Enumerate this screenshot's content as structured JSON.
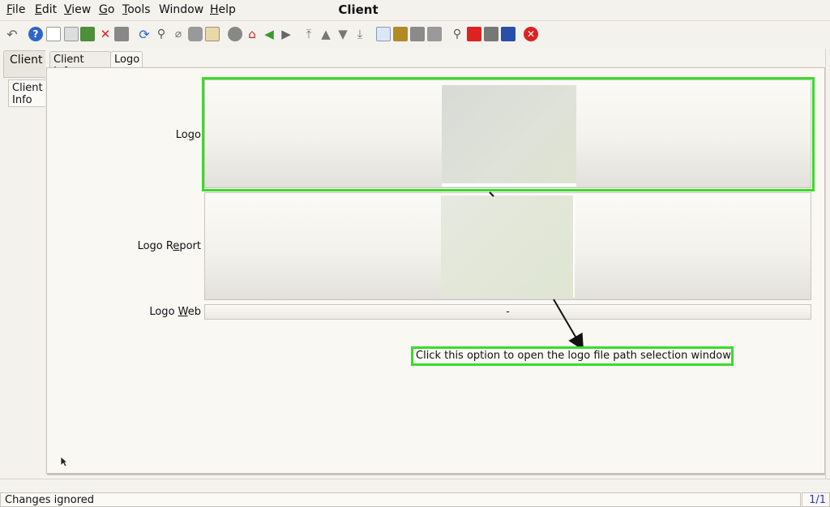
{
  "menubar": {
    "items": [
      {
        "pre": "",
        "key": "F",
        "post": "ile"
      },
      {
        "pre": "",
        "key": "E",
        "post": "dit"
      },
      {
        "pre": "",
        "key": "V",
        "post": "iew"
      },
      {
        "pre": "",
        "key": "G",
        "post": "o"
      },
      {
        "pre": "",
        "key": "T",
        "post": "ools"
      },
      {
        "pre": "Window",
        "key": "",
        "post": ""
      },
      {
        "pre": "",
        "key": "H",
        "post": "elp"
      }
    ],
    "title": "Client"
  },
  "toolbar": {
    "icons": [
      "undo-icon",
      "help-icon",
      "new-record-icon",
      "copy-record-icon",
      "save-record-icon",
      "delete-icon",
      "save-icon",
      "refresh-icon",
      "find-icon",
      "attachment-icon",
      "chat-icon",
      "history-icon",
      "archive-icon",
      "home-icon",
      "back-icon",
      "forward-icon",
      "first-record-icon",
      "previous-record-icon",
      "next-record-icon",
      "last-record-icon",
      "report-icon",
      "print-preview-icon",
      "print-icon",
      "zoom-across-icon",
      "workflow-icon",
      "product-info-icon",
      "request-icon",
      "close-window-icon"
    ]
  },
  "tabs": {
    "left_tab": "Client",
    "left_subtab": "Client Info",
    "subtabs": [
      "Client Info",
      "Logo"
    ],
    "active_subtab": "Logo"
  },
  "fields": {
    "logo": {
      "pre": "Lo",
      "key": "g",
      "post": "o"
    },
    "logo_report": {
      "pre": "Logo R",
      "key": "e",
      "post": "port"
    },
    "logo_web": {
      "pre": "Logo ",
      "key": "W",
      "post": "eb"
    },
    "logo_web_value": "-"
  },
  "annotation": {
    "callout": "Click this option to open the logo file path selection window",
    "color": "#3adb2a"
  },
  "status": {
    "message": "Changes ignored",
    "count": "1/1"
  }
}
